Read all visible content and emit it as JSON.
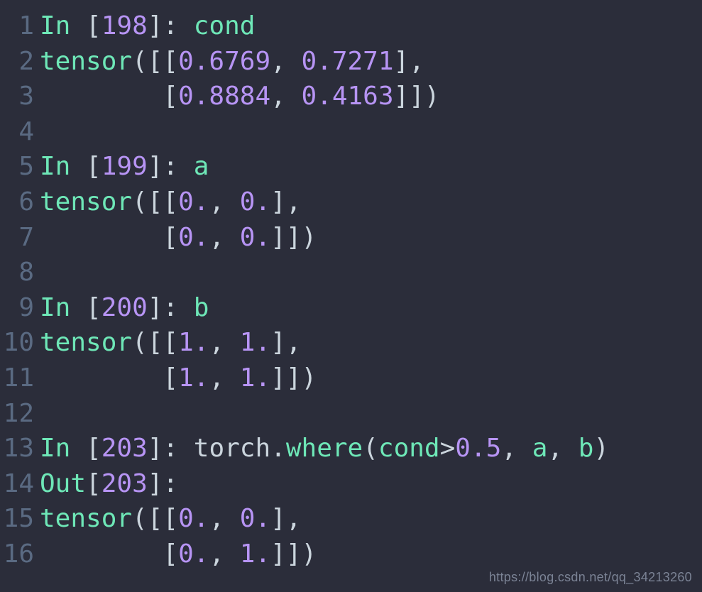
{
  "watermark": "https://blog.csdn.net/qq_34213260",
  "lines": [
    {
      "n": "1",
      "html": "<span class='c-prompt'>In </span><span class='c-punc'>[</span><span class='c-num'>198</span><span class='c-punc'>]: </span><span class='c-ident'>cond</span>"
    },
    {
      "n": "2",
      "html": "<span class='c-tensor'>tensor</span><span class='c-punc'>([[</span><span class='c-num'>0.6769</span><span class='c-punc'>, </span><span class='c-num'>0.7271</span><span class='c-punc'>],</span>"
    },
    {
      "n": "3",
      "html": "<span class='c-punc'>        [</span><span class='c-num'>0.8884</span><span class='c-punc'>, </span><span class='c-num'>0.4163</span><span class='c-punc'>]])</span>"
    },
    {
      "n": "4",
      "html": ""
    },
    {
      "n": "5",
      "html": "<span class='c-prompt'>In </span><span class='c-punc'>[</span><span class='c-num'>199</span><span class='c-punc'>]: </span><span class='c-ident'>a</span>"
    },
    {
      "n": "6",
      "html": "<span class='c-tensor'>tensor</span><span class='c-punc'>([[</span><span class='c-num'>0.</span><span class='c-punc'>, </span><span class='c-num'>0.</span><span class='c-punc'>],</span>"
    },
    {
      "n": "7",
      "html": "<span class='c-punc'>        [</span><span class='c-num'>0.</span><span class='c-punc'>, </span><span class='c-num'>0.</span><span class='c-punc'>]])</span>"
    },
    {
      "n": "8",
      "html": ""
    },
    {
      "n": "9",
      "html": "<span class='c-prompt'>In </span><span class='c-punc'>[</span><span class='c-num'>200</span><span class='c-punc'>]: </span><span class='c-ident'>b</span>"
    },
    {
      "n": "10",
      "html": "<span class='c-tensor'>tensor</span><span class='c-punc'>([[</span><span class='c-num'>1.</span><span class='c-punc'>, </span><span class='c-num'>1.</span><span class='c-punc'>],</span>"
    },
    {
      "n": "11",
      "html": "<span class='c-punc'>        [</span><span class='c-num'>1.</span><span class='c-punc'>, </span><span class='c-num'>1.</span><span class='c-punc'>]])</span>"
    },
    {
      "n": "12",
      "html": ""
    },
    {
      "n": "13",
      "html": "<span class='c-prompt'>In </span><span class='c-punc'>[</span><span class='c-num'>203</span><span class='c-punc'>]: </span><span class='c-mod'>torch</span><span class='c-dot'>.</span><span class='c-fn'>where</span><span class='c-punc'>(</span><span class='c-ident'>cond</span><span class='c-op'>&gt;</span><span class='c-num'>0.5</span><span class='c-punc'>, </span><span class='c-ident'>a</span><span class='c-punc'>, </span><span class='c-ident'>b</span><span class='c-punc'>)</span>"
    },
    {
      "n": "14",
      "html": "<span class='c-out'>Out</span><span class='c-punc'>[</span><span class='c-num'>203</span><span class='c-punc'>]:</span>"
    },
    {
      "n": "15",
      "html": "<span class='c-tensor'>tensor</span><span class='c-punc'>([[</span><span class='c-num'>0.</span><span class='c-punc'>, </span><span class='c-num'>0.</span><span class='c-punc'>],</span>"
    },
    {
      "n": "16",
      "html": "<span class='c-punc'>        [</span><span class='c-num'>0.</span><span class='c-punc'>, </span><span class='c-num'>1.</span><span class='c-punc'>]])</span>"
    }
  ],
  "chart_data": {
    "type": "table",
    "description": "IPython session showing torch.where example",
    "cells": [
      {
        "prompt": "In [198]",
        "expr": "cond",
        "result": "tensor([[0.6769, 0.7271],[0.8884, 0.4163]])"
      },
      {
        "prompt": "In [199]",
        "expr": "a",
        "result": "tensor([[0., 0.],[0., 0.]])"
      },
      {
        "prompt": "In [200]",
        "expr": "b",
        "result": "tensor([[1., 1.],[1., 1.]])"
      },
      {
        "prompt": "In [203]",
        "expr": "torch.where(cond>0.5, a, b)",
        "out_prompt": "Out[203]",
        "result": "tensor([[0., 0.],[0., 1.]])"
      }
    ],
    "tensors": {
      "cond": [
        [
          0.6769,
          0.7271
        ],
        [
          0.8884,
          0.4163
        ]
      ],
      "a": [
        [
          0.0,
          0.0
        ],
        [
          0.0,
          0.0
        ]
      ],
      "b": [
        [
          1.0,
          1.0
        ],
        [
          1.0,
          1.0
        ]
      ],
      "where_cond_gt_0_5_a_b": [
        [
          0.0,
          0.0
        ],
        [
          0.0,
          1.0
        ]
      ]
    }
  }
}
